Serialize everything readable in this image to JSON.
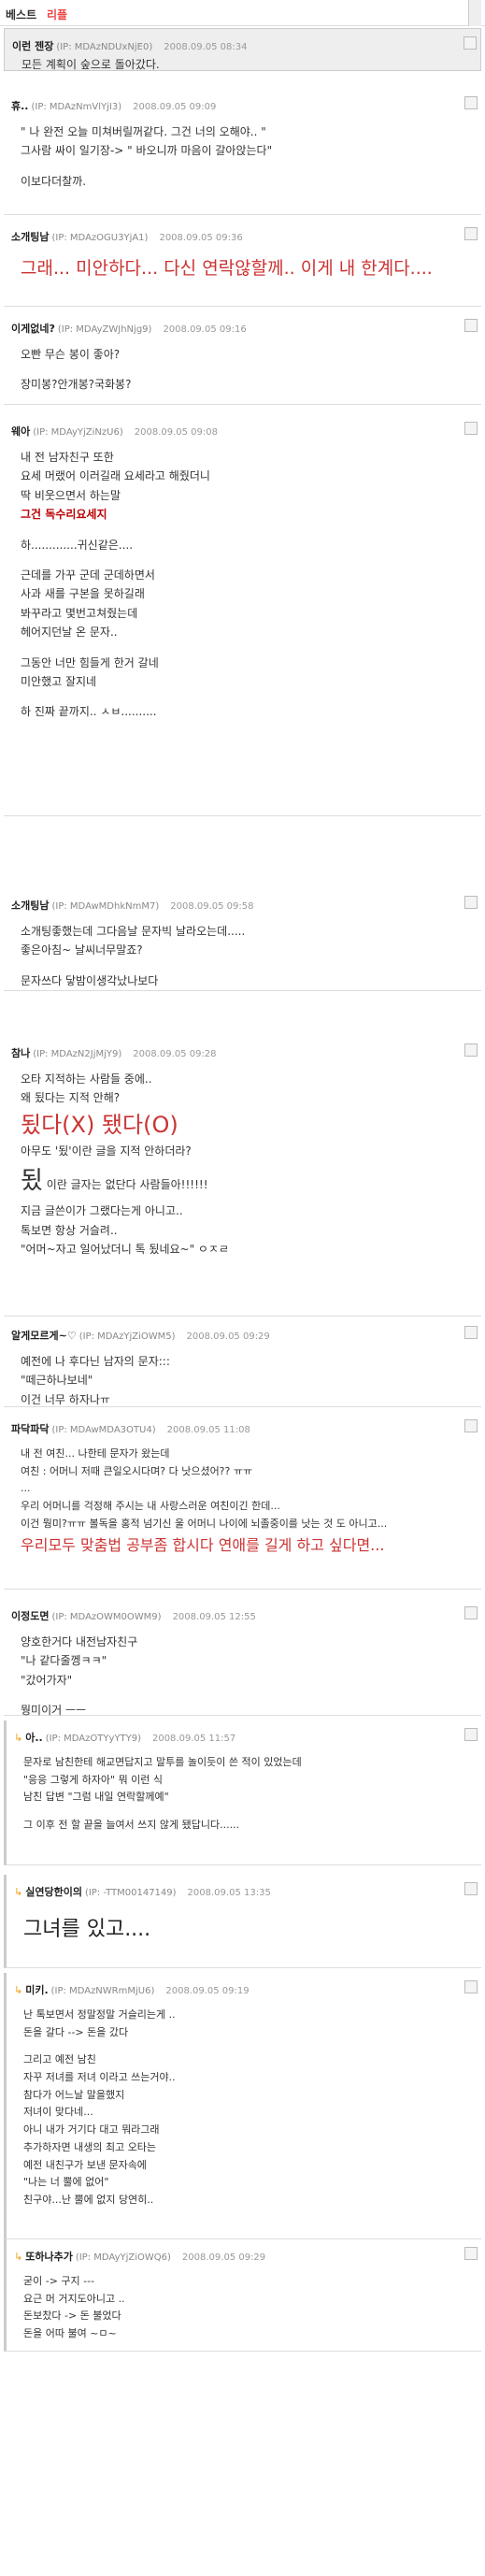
{
  "header": {
    "t1": "베스트",
    "t2": "리플"
  },
  "comments": [
    {
      "nick": "이런 젠장",
      "ip": "(IP: MDAzNDUxNjE0)",
      "date": "2008.09.05 08:34",
      "lines": [
        "모든 계획이 숲으로 돌아갔다."
      ]
    },
    {
      "nick": "휴..",
      "ip": "(IP: MDAzNmVlYjI3)",
      "date": "2008.09.05 09:09",
      "lines": [
        "\" 나 완전 오늘 미쳐버릴꺼같다. 그건 너의 오해야.. \"",
        "그사람 싸이 일기장-> \" 바오니까 마음이 갈아앉는다\"",
        "",
        "이보다더찰까."
      ]
    },
    {
      "nick": "소개팅남",
      "ip": "(IP: MDAzOGU3YjA1)",
      "date": "2008.09.05 09:36",
      "big": "그래... 미안하다... 다신 연락않할께.. 이게 내 한계다...."
    },
    {
      "nick": "이게없네?",
      "ip": "(IP: MDAyZWJhNjg9)",
      "date": "2008.09.05 09:16",
      "lines": [
        "오빤 무슨 봉이 좋아?",
        "",
        "장미봉?안개봉?국화봉?"
      ]
    },
    {
      "nick": "웨아",
      "ip": "(IP: MDAyYjZiNzU6)",
      "date": "2008.09.05 09:08",
      "lines": [
        "내 전 남자친구 또한",
        "요세 머랬어 이러길래 요세라고 해줬더니",
        "딱 비웃으면서 하는말",
        "그건 독수리요세지",
        "",
        "하.............귀신같은....",
        "",
        "근데를 가꾸 군데 군데하면서",
        "사과 새를 구본을 못하길래",
        "봐꾸라고 몇번고쳐줬는데",
        "헤어지던날 온 문자..",
        "",
        "그동안 너만 힘들게 한거 갈네",
        "미안했고 잘지네",
        "",
        "하 진짜 끝까지.. ㅅㅂ.........."
      ]
    },
    {
      "nick": "소개팅남",
      "ip": "(IP: MDAwMDhkNmM7)",
      "date": "2008.09.05 09:58",
      "lines": [
        "소개팅좋했는데 그다음날 문자빅 날라오는데.....",
        "좋은아침~ 날씨너무말죠?",
        "",
        "문자쓰다 닿밤이생각났나보다"
      ]
    },
    {
      "nick": "참나",
      "ip": "(IP: MDAzN2JjMjY9)",
      "date": "2008.09.05 09:28",
      "lines": [
        "오타 지적하는 사람들 중에..",
        "왜 됬다는 지적 안해?"
      ],
      "big2": "됬다(X) 됐다(O)",
      "lines2": [
        "아무도 '됬'이란 글을 지적 안하더라?"
      ],
      "huge": "됬",
      "huge_tail": "이란 글자는 없단다 사람들아!!!!!!",
      "lines3": [
        "지금 글쓴이가 그랬다는게 아니고..",
        "톡보면 항상 거슬려..",
        "\"어머~자고 일어났더니 톡 됬네요~\" ㅇㅈㄹ"
      ]
    },
    {
      "nick": "알게모르게~♡",
      "ip": "(IP: MDAzYjZiOWM5)",
      "date": "2008.09.05 09:29",
      "lines": [
        "예전에 나 후다닌 남자의 문자:::",
        "\"떼근하나보네\"",
        "이건 너무 하자나ㅠ"
      ]
    },
    {
      "nick": "파닥파닥",
      "ip": "(IP: MDAwMDA3OTU4)",
      "date": "2008.09.05 11:08",
      "lines": [
        "내 전 여친... 나한테 문자가 왔는데",
        "여친 : 어머니 저때 큰일오시다며? 다 낫으셨어?? ㅠㅠ",
        "...",
        "우리 어머니를 걱정해 주시는 내 사랑스러운 여친이긴 한데...",
        "이건 뭥미?ㅠㅠ 볼독을 홍적 넘기신 울 어머니 나이에 뇌졸중이를 낫는 것 도 아니고..."
      ],
      "big3": "우리모두 맞춤법 공부좀 합시다 연애를 길게 하고 싶다면..."
    },
    {
      "nick": "이정도면",
      "ip": "(IP: MDAzOWM0OWM9)",
      "date": "2008.09.05 12:55",
      "lines": [
        "양호한거다 내전남자친구",
        "\"나 같다줄껭ㅋㅋ\"",
        "\"갔어가자\"",
        "",
        "뭥미이거 ㅡㅡ"
      ]
    },
    {
      "nick": "아..",
      "ip": "(IP: MDAzOTYyYTY9)",
      "date": "2008.09.05 11:57",
      "reply": true,
      "lines": [
        "문자로 남친한테 해교면답지고 말투를 놀이듯이 쓴 적이 있었는데",
        "\"응응 그렇게 하자아\" 뭐 이런 식",
        "남친 답변 \"그럼 내일 연락할께예\"",
        "",
        "그 이후 전 할 끝을 늘여서 쓰지 않게 됐답니다......"
      ]
    },
    {
      "nick": "실연당한이의",
      "ip": "(IP: -TTM00147149)",
      "date": "2008.09.05 13:35",
      "reply": true,
      "big4": "그녀를 있고...."
    },
    {
      "nick": "미키.",
      "ip": "(IP: MDAzNWRmMjU6)",
      "date": "2008.09.05 09:19",
      "reply": true,
      "lines": [
        "난 톡보면서 정말정말 거슬리는게 ..",
        "돈을 갈다 --> 돈을 갔다",
        "",
        "그리고 예전 남친",
        "자꾸 저녀를 저녀 이라고 쓰는거야..",
        "참다가 어느날 말을했지",
        "저녀이 맞다네...",
        "아니 내가 거기다 대고 뭐라그래",
        "추가하자면 내생의 최고 오타는",
        "예전 내친구가 보낸 문자속에",
        "\"나는 너 뿔에 없어\"",
        "친구야...난 뿔에 없지 당연히.."
      ]
    },
    {
      "nick": "또하나추가",
      "ip": "(IP: MDAyYjZiOWQ6)",
      "date": "2008.09.05 09:29",
      "reply": true,
      "lines": [
        "굳이 -> 구지 ---",
        "요근 머 거지도아니고 ..",
        "돈보찼다 -> 돈 불었다",
        "돈을 어따 불여 ~ㅁ~"
      ]
    }
  ]
}
